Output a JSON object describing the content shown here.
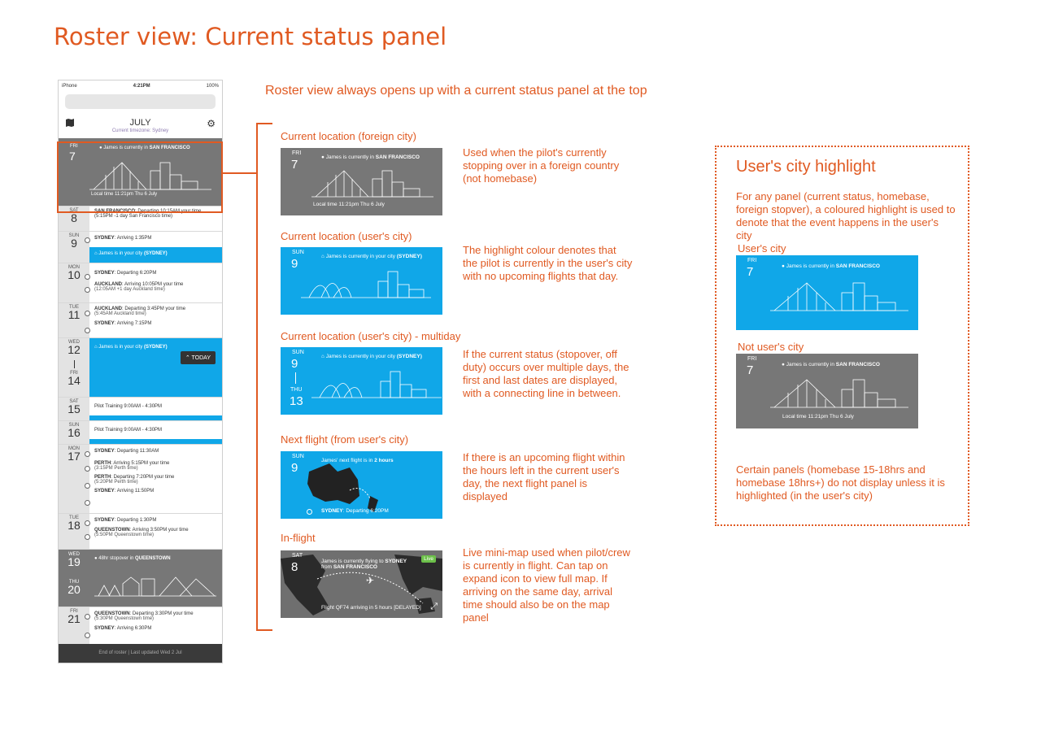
{
  "page_title": "Roster view: Current status panel",
  "intro": "Roster view always opens up with a current status panel at the top",
  "phone": {
    "status": {
      "carrier": "iPhone",
      "time": "4:21PM",
      "battery": "100%"
    },
    "month": "JULY",
    "timezone": "Current timezone: Sydney",
    "current": {
      "weekday": "FRI",
      "day": "7",
      "location_prefix": "James is currently in",
      "location_city": "SAN FRANCISCO",
      "local_time": "Local time 11:21pm Thu 6 July"
    },
    "rows": [
      {
        "weekday": "SAT",
        "day": "8",
        "lines": [
          {
            "b": "SAN FRANCISCO",
            "t": ": Departing 10:15AM your time (5:15PM -1 day San Francisco time)"
          }
        ]
      },
      {
        "weekday": "SUN",
        "day": "9",
        "lines": [
          {
            "b": "SYDNEY",
            "t": ": Arriving 1:35PM"
          }
        ]
      },
      {
        "banner": "James is in your city ",
        "banner_city": "(SYDNEY)"
      },
      {
        "weekday": "MON",
        "day": "10",
        "lines": [
          {
            "b": "SYDNEY",
            "t": ": Departing 6:20PM"
          },
          {
            "b": "AUCKLAND",
            "t": ": Arriving 10:05PM your time",
            "sub": "(12:05AM +1 day Auckland time)"
          }
        ]
      },
      {
        "weekday": "TUE",
        "day": "11",
        "lines": [
          {
            "b": "AUCKLAND",
            "t": ": Departing 3:45PM your time",
            "sub": "(5:45AM Auckland time)"
          },
          {
            "b": "SYDNEY",
            "t": ": Arriving 7:15PM"
          }
        ]
      }
    ],
    "multi": {
      "w1": "WED",
      "d1": "12",
      "w2": "FRI",
      "d2": "14",
      "banner": "James is in your city ",
      "city": "(SYDNEY)",
      "today_btn": "TODAY"
    },
    "training": [
      {
        "weekday": "SAT",
        "day": "15",
        "text": "Pilot Training 9:00AM - 4:30PM"
      },
      {
        "weekday": "SUN",
        "day": "16",
        "text": "Pilot Training 9:00AM - 4:30PM"
      }
    ],
    "day17": {
      "weekday": "MON",
      "day": "17",
      "lines": [
        {
          "b": "SYDNEY",
          "t": ": Departing 11:30AM"
        },
        {
          "b": "PERTH",
          "t": ": Arriving 5:15PM your time",
          "sub": "(3:15PM Perth time)"
        },
        {
          "b": "PERTH",
          "t": ": Departing 7:20PM your time",
          "sub": "(5:20PM Perth time)"
        },
        {
          "b": "SYDNEY",
          "t": ": Arriving 11:50PM"
        }
      ]
    },
    "day18": {
      "weekday": "TUE",
      "day": "18",
      "lines": [
        {
          "b": "SYDNEY",
          "t": ": Departing 1:30PM"
        },
        {
          "b": "QUEENSTOWN",
          "t": ": Arriving 3:50PM your time",
          "sub": "(5:50PM Queenstown time)"
        }
      ]
    },
    "stopover": {
      "w1": "WED",
      "d1": "19",
      "w2": "THU",
      "d2": "20",
      "text": "48hr stopover in ",
      "city": "QUEENSTOWN"
    },
    "day21": {
      "weekday": "FRI",
      "day": "21",
      "lines": [
        {
          "b": "QUEENSTOWN",
          "t": ": Departing 3:30PM your time",
          "sub": "(5:30PM Queenstown time)"
        },
        {
          "b": "SYDNEY",
          "t": ": Arriving 6:30PM"
        }
      ]
    },
    "footer": "End of roster | Last updated Wed 2 Jul"
  },
  "panels": [
    {
      "label": "Current location (foreign city)",
      "weekday": "FRI",
      "day": "7",
      "loc": "James is currently in ",
      "city": "SAN FRANCISCO",
      "local": "Local time 11:21pm Thu 6 July",
      "desc": "Used when the pilot's currently stopping over in a foreign country (not homebase)"
    },
    {
      "label": "Current location (user's city)",
      "weekday": "SUN",
      "day": "9",
      "loc": "James is currently in your city ",
      "city": "(SYDNEY)",
      "desc": "The highlight colour denotes that the pilot is currently in the user's city with no upcoming flights that day."
    },
    {
      "label": "Current location (user's city) - multiday",
      "weekday": "SUN",
      "day": "9",
      "weekday2": "THU",
      "day2": "13",
      "loc": "James is currently in your city ",
      "city": "(SYDNEY)",
      "desc": "If the current status (stopover, off duty) occurs over multiple days, the first and last dates are displayed, with a connecting line in between."
    },
    {
      "label": "Next flight (from user's city)",
      "weekday": "SUN",
      "day": "9",
      "loc": "James' next flight is in ",
      "city": "2 hours",
      "dep_city": "SYDNEY",
      "dep": ": Departing 6:20PM",
      "desc": "If there is an upcoming flight within the hours left in the current user's day, the next flight panel is displayed"
    },
    {
      "label": "In-flight",
      "weekday": "SAT",
      "day": "8",
      "loc": "James is currently flying to ",
      "city": "SYDNEY",
      "from": "from ",
      "from_city": "SAN FRANCISCO",
      "live": "Live",
      "flight": "Flight QF74 arriving in 5 hours [DELAYED]",
      "desc": "Live mini-map used when pilot/crew is currently in flight. Can tap on expand icon to view full map. If arriving on the same day, arrival time should also be on the map panel"
    }
  ],
  "highlight": {
    "title": "User's city highlight",
    "desc": "For any panel (current status, homebase, foreign stopver), a coloured highlight is used to denote that the event happens in the user's city",
    "users_city": "User's city",
    "not_users_city": "Not user's city",
    "weekday": "FRI",
    "day": "7",
    "loc": "James is currently in ",
    "city": "SAN FRANCISCO",
    "local": "Local time 11:21pm Thu 6 July",
    "note": "Certain panels (homebase 15-18hrs and homebase 18hrs+) do not display unless it is highlighted (in the user's city)"
  },
  "colors": {
    "accent": "#e05a22",
    "blue": "#10a7e8",
    "grey": "#777777"
  }
}
